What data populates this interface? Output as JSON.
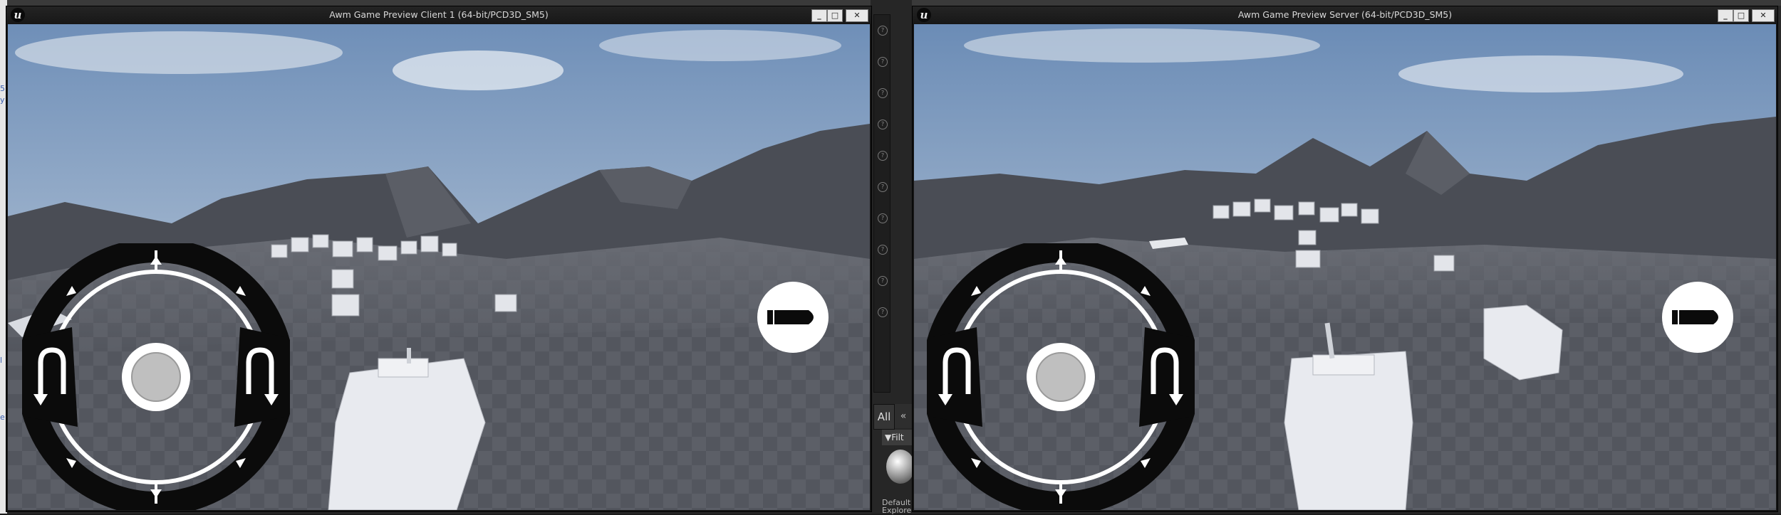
{
  "editor": {
    "side_ticks": [
      "5",
      "y",
      "l",
      "e"
    ],
    "content_tab_all": "All",
    "content_tab_arrow": "«",
    "filters_label": "Filt",
    "default_label": "Default",
    "explorer_label": "Explore"
  },
  "client_window": {
    "title": "Awm Game Preview Client 1 (64-bit/PCD3D_SM5)",
    "buttons": {
      "minimize": "_",
      "maximize": "□",
      "close": "✕"
    }
  },
  "server_window": {
    "title": "Awm Game Preview Server (64-bit/PCD3D_SM5)",
    "buttons": {
      "minimize": "_",
      "maximize": "□",
      "close": "✕"
    }
  },
  "hud": {
    "joystick_icon": "dpad-ring",
    "fire_icon": "bullet-icon",
    "turn_left_icon": "u-turn-left-icon",
    "turn_right_icon": "u-turn-right-icon"
  },
  "colors": {
    "sky_top": "#6f8fb8",
    "sky_bottom": "#c9d3dd",
    "mountain": "#4a4d55",
    "ground": "#5f626a",
    "hud_dark": "#0b0b0b",
    "hud_white": "#ffffff"
  }
}
